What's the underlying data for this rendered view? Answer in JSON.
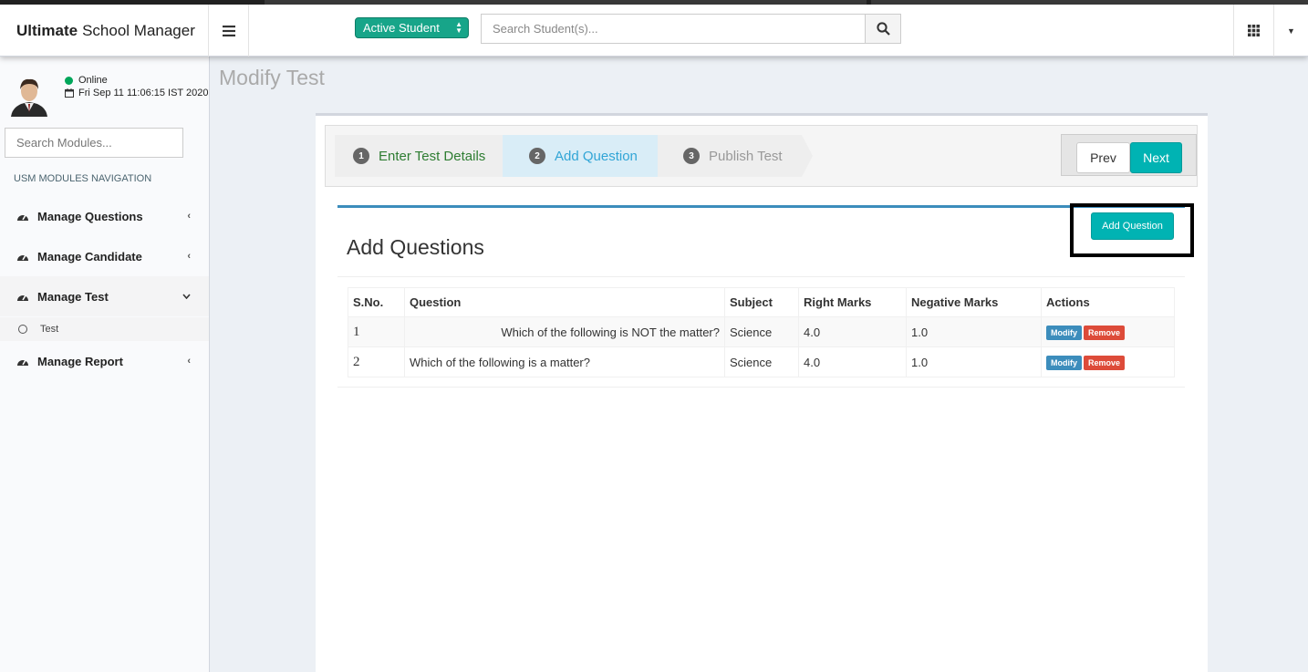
{
  "app": {
    "title_bold": "Ultimate",
    "title_rest": "School Manager"
  },
  "header": {
    "status_select": "Active Student",
    "search_placeholder": "Search Student(s)..."
  },
  "sidebar": {
    "user_status": "Online",
    "datetime": "Fri Sep 11 11:06:15 IST 2020",
    "module_search_placeholder": "Search Modules...",
    "nav_header": "USM MODULES NAVIGATION",
    "items": [
      {
        "label": "Manage Questions"
      },
      {
        "label": "Manage Candidate"
      },
      {
        "label": "Manage Test"
      },
      {
        "label": "Manage Report"
      }
    ],
    "sub_items": [
      {
        "label": "Test"
      }
    ]
  },
  "page": {
    "title": "Modify Test"
  },
  "wizard": {
    "steps": [
      {
        "num": "1",
        "label": "Enter Test Details"
      },
      {
        "num": "2",
        "label": "Add Question"
      },
      {
        "num": "3",
        "label": "Publish Test"
      }
    ],
    "prev_label": "Prev",
    "next_label": "Next"
  },
  "questions_section": {
    "title": "Add Questions",
    "add_button": "Add Question",
    "columns": [
      "S.No.",
      "Question",
      "Subject",
      "Right Marks",
      "Negative Marks",
      "Actions"
    ],
    "rows": [
      {
        "sno": "1",
        "question": "Which of the following is NOT the matter?",
        "subject": "Science",
        "right": "4.0",
        "negative": "1.0"
      },
      {
        "sno": "2",
        "question": "Which of the following is a matter?",
        "subject": "Science",
        "right": "4.0",
        "negative": "1.0"
      }
    ],
    "modify_label": "Modify",
    "remove_label": "Remove"
  },
  "colors": {
    "accent": "#00b3b3",
    "step_active_bg": "#d9edf7",
    "modify_btn": "#3c8dbc",
    "remove_btn": "#dd4b39",
    "online_dot": "#00a65a"
  }
}
